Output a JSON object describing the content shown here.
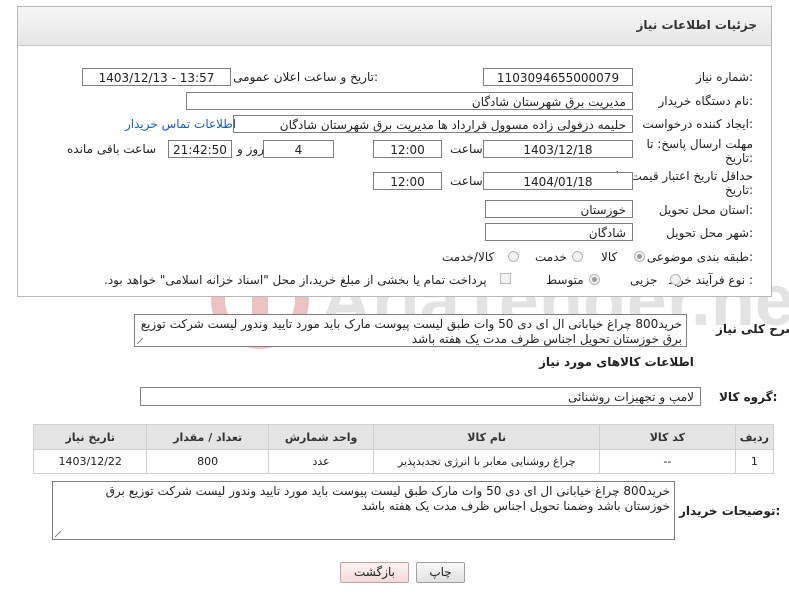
{
  "header": {
    "title": "جزئیات اطلاعات نیاز"
  },
  "form": {
    "need_number_label": "شماره نیاز:",
    "need_number": "1103094655000079",
    "announce_label": "تاریخ و ساعت اعلان عمومی:",
    "announce_value": "1403/12/13 - 13:57",
    "buyer_org_label": "نام دستگاه خریدار:",
    "buyer_org": "مدیریت برق شهرستان شادگان",
    "requester_label": "ایجاد کننده درخواست:",
    "requester": "حلیمه دزفولی زاده مسوول قرارداد ها مدیریت برق شهرستان شادگان",
    "contact_link": "اطلاعات تماس خریدار",
    "deadline_label_1": "مهلت ارسال پاسخ: تا",
    "deadline_label_2": "تاریخ:",
    "deadline_date": "1403/12/18",
    "time_label": "ساعت",
    "deadline_time": "12:00",
    "days_value": "4",
    "days_label": "روز و",
    "remaining_time": "21:42:50",
    "remaining_label": "ساعت باقی مانده",
    "validity_label_1": "حداقل تاریخ اعتبار قیمت: تا",
    "validity_label_2": "تاریخ:",
    "validity_date": "1404/01/18",
    "validity_time_label": "ساعت",
    "validity_time": "12:00",
    "province_label": "استان محل تحویل:",
    "province": "خوزستان",
    "city_label": "شهر محل تحویل:",
    "city": "شادگان",
    "category_label": "طبقه بندی موضوعی:",
    "category_options": [
      "کالا",
      "خدمت",
      "کالا/خدمت"
    ],
    "process_label": "نوع فرآیند خرید :",
    "process_options": [
      "جزیی",
      "متوسط"
    ],
    "payment_note": "پرداخت تمام یا بخشی از مبلغ خرید،از محل \"اسناد خزانه اسلامی\" خواهد بود."
  },
  "description": {
    "label": "شرح کلی نیاز:",
    "text": "خرید800 چراغ خیابانی ال ای دی 50  وات  طبق لیست پیوست مارک باید مورد تایید وندور لیست شرکت توزیع برق خوزستان  تحویل اجناس ظرف مدت یک هفته باشد"
  },
  "goods": {
    "section_title": "اطلاعات کالاهای مورد نیاز",
    "group_label": "گروه کالا:",
    "group_value": "لامپ و تجهیزات روشنائی",
    "columns": [
      "ردیف",
      "کد کالا",
      "نام کالا",
      "واحد شمارش",
      "تعداد / مقدار",
      "تاریخ نیاز"
    ],
    "rows": [
      [
        "1",
        "--",
        "چراغ روشنایی معابر با انرژی تجدیدپذیر",
        "عدد",
        "800",
        "1403/12/22"
      ]
    ]
  },
  "buyer_notes": {
    "label": "توضیحات خریدار:",
    "text": "خرید800 چراغ خیابانی ال ای دی 50 وات مارک طبق لیست پیوست باید مورد تایید وندور لیست شرکت توزیع برق خوزستان باشد وضمنا تحویل اجناس ظرف مدت یک هفته باشد"
  },
  "buttons": {
    "print": "چاپ",
    "back": "بازگشت"
  },
  "watermark": {
    "text": "AriaTender.neT"
  },
  "colors": {
    "link": "#1a5fb4",
    "watermark": "#d9d9d9",
    "watermark_accent": "#e8b4b4",
    "back_button": "#f2dada"
  },
  "icons": {
    "watermark_logo": "red-circular-logo"
  }
}
